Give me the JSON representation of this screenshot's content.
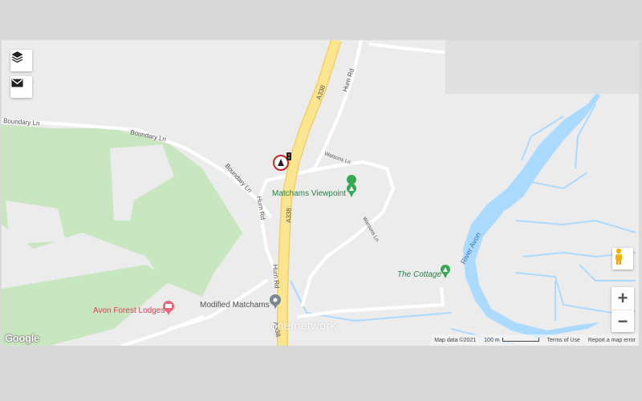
{
  "controls": {
    "layers_icon": "layers-icon",
    "mail_icon": "mail-icon",
    "zoom_in": "+",
    "zoom_out": "−"
  },
  "roads": {
    "boundary_ln_1": "Boundary Ln",
    "boundary_ln_2": "Boundary Ln",
    "boundary_ln_3": "Boundary Ln",
    "a338_top": "A338",
    "a338_mid": "A338",
    "a338_bottom": "A338",
    "hurn_rd_top": "Hurn Rd",
    "hurn_rd_mid": "Hurn Rd",
    "hurn_rd_bottom": "Hurn Rd",
    "watsons_ln_1": "Watsons Ln",
    "watsons_ln_2": "Watsons Ln",
    "river": "River Avon"
  },
  "places": {
    "viewpoint": "Matchams Viewpoint",
    "cottage": "The Cottage",
    "lodges": "Avon Forest Lodges",
    "modified": "Modified Matchams"
  },
  "watermark": "one.network",
  "footer": {
    "map_data": "Map data ©2021",
    "scale": "100 m",
    "terms": "Terms of Use",
    "report": "Report a map error"
  },
  "logo": "Google",
  "colors": {
    "forest": "#c8e6c0",
    "water": "#aadaff",
    "highway": "#fbe58e",
    "land": "#ececec"
  }
}
